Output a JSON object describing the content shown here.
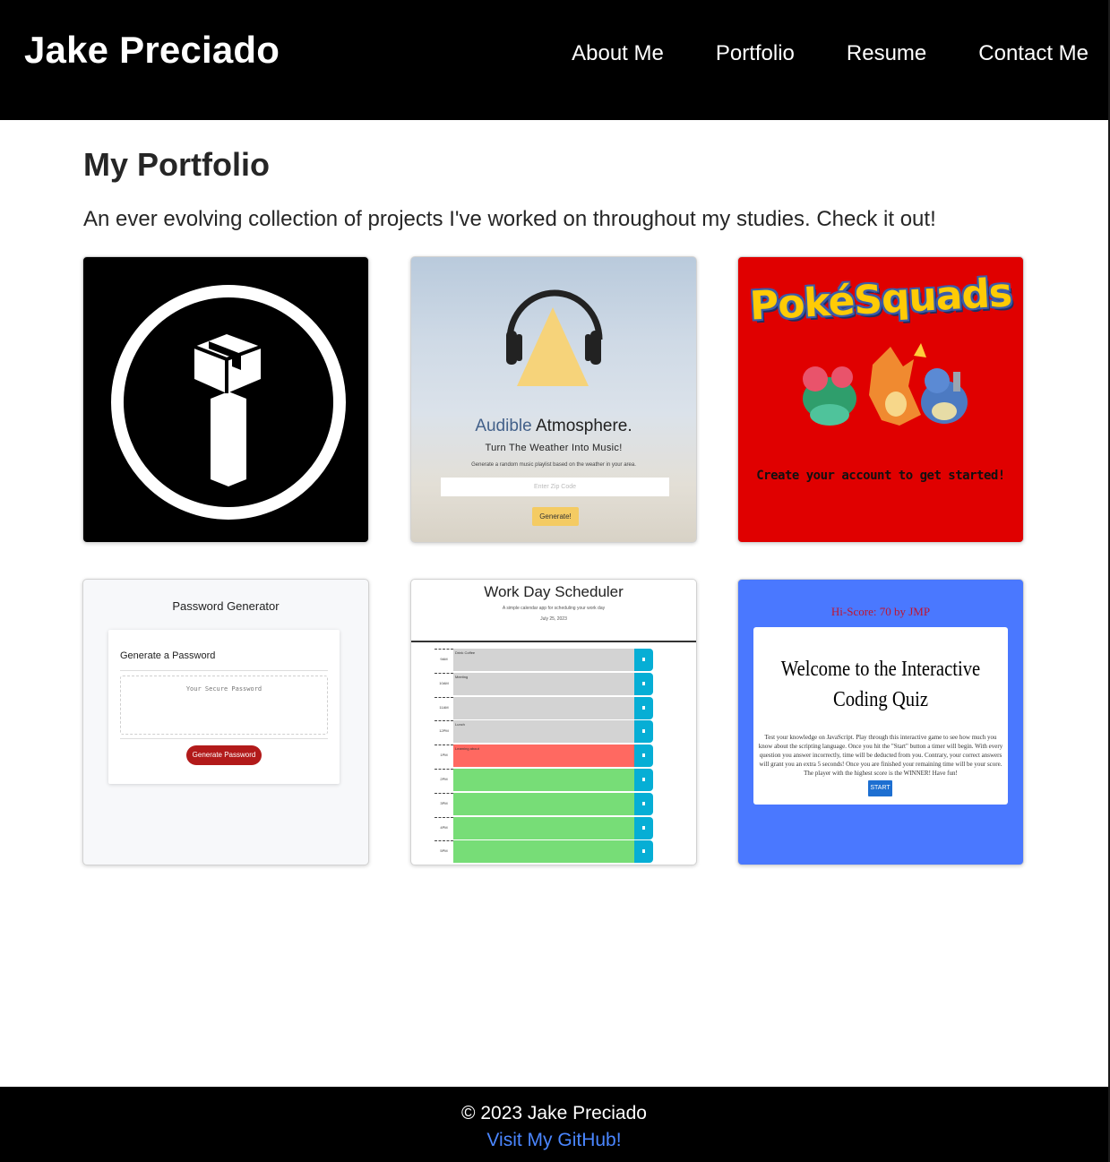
{
  "header": {
    "brand": "Jake Preciado",
    "nav": [
      "About Me",
      "Portfolio",
      "Resume",
      "Contact Me"
    ]
  },
  "main": {
    "title": "My Portfolio",
    "intro": "An ever evolving collection of projects I've worked on throughout my studies. Check it out!"
  },
  "projects": {
    "audible": {
      "title_part1": "Audible",
      "title_part2": "Atmosphere.",
      "subtitle": "Turn The Weather Into Music!",
      "description": "Generate a random music playlist based on the weather in your area.",
      "input_placeholder": "Enter Zip Code",
      "button": "Generate!"
    },
    "pokesquads": {
      "logo": "PokéSquads",
      "cta": "Create your account to get started!"
    },
    "password": {
      "title": "Password Generator",
      "subtitle": "Generate a Password",
      "placeholder": "Your Secure Password",
      "button": "Generate Password"
    },
    "scheduler": {
      "title": "Work Day Scheduler",
      "subtitle": "A simple calendar app for scheduling your work day",
      "date": "July 25, 2023",
      "rows": [
        {
          "hour": "9AM",
          "text": "Drink Coffee",
          "state": "past"
        },
        {
          "hour": "10AM",
          "text": "Meeting",
          "state": "past"
        },
        {
          "hour": "11AM",
          "text": "",
          "state": "past"
        },
        {
          "hour": "12PM",
          "text": "Lunch",
          "state": "past"
        },
        {
          "hour": "1PM",
          "text": "Learning about",
          "state": "present"
        },
        {
          "hour": "2PM",
          "text": "",
          "state": "future"
        },
        {
          "hour": "3PM",
          "text": "",
          "state": "future"
        },
        {
          "hour": "4PM",
          "text": "",
          "state": "future"
        },
        {
          "hour": "5PM",
          "text": "",
          "state": "future"
        }
      ]
    },
    "quiz": {
      "hiscore": "Hi-Score: 70 by JMP",
      "title": "Welcome to the Interactive Coding Quiz",
      "description": "Test your knowledge on JavaScript. Play through this interactive game to see how much you know about the scripting language. Once you hit the \"Start\" button a timer will begin. With every question you answer incorrectly, time will be deducted from you. Contrary, your correct answers will grant you an extra 5 seconds! Once you are finished your remaining time will be your score. The player with the highest score is the WINNER! Have fun!",
      "button": "START"
    }
  },
  "footer": {
    "copyright": "© 2023 Jake Preciado",
    "github": "Visit My GitHub!"
  },
  "colors": {
    "header_bg": "#000000",
    "link_blue": "#4a86ff",
    "pokesquads_red": "#e00000",
    "quiz_blue": "#4a78ff",
    "audible_yellow": "#f4cb63"
  }
}
